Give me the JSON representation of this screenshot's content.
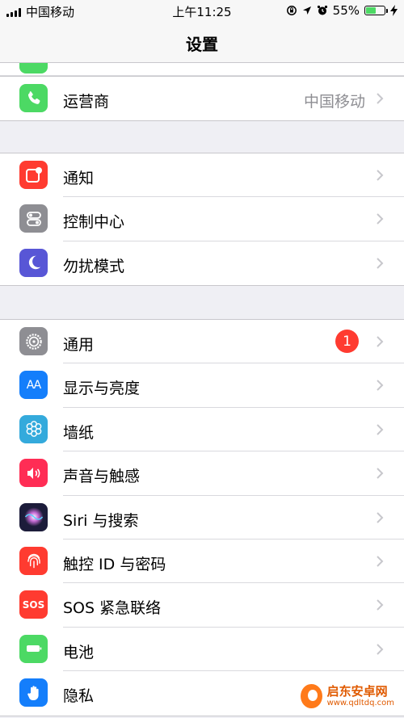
{
  "status_bar": {
    "carrier": "中国移动",
    "time": "上午11:25",
    "battery_percent": "55%",
    "battery_level": 0.55
  },
  "nav": {
    "title": "设置"
  },
  "groups": [
    {
      "rows": [
        {
          "label": "运营商",
          "value": "中国移动",
          "icon": "phone-icon"
        }
      ]
    },
    {
      "rows": [
        {
          "label": "通知",
          "icon": "notifications-icon"
        },
        {
          "label": "控制中心",
          "icon": "control-center-icon"
        },
        {
          "label": "勿扰模式",
          "icon": "moon-icon"
        }
      ]
    },
    {
      "rows": [
        {
          "label": "通用",
          "badge": "1",
          "icon": "gear-icon"
        },
        {
          "label": "显示与亮度",
          "icon": "display-icon"
        },
        {
          "label": "墙纸",
          "icon": "wallpaper-icon"
        },
        {
          "label": "声音与触感",
          "icon": "sound-icon"
        },
        {
          "label": "Siri 与搜索",
          "icon": "siri-icon"
        },
        {
          "label": "触控 ID 与密码",
          "icon": "fingerprint-icon"
        },
        {
          "label": "SOS 紧急联络",
          "icon": "sos-icon"
        },
        {
          "label": "电池",
          "icon": "battery-icon"
        },
        {
          "label": "隐私",
          "icon": "hand-icon"
        }
      ]
    }
  ],
  "icons": {
    "display_text": "AA",
    "sos_text": "SOS"
  },
  "colors": {
    "phone": "#4cd964",
    "notifications": "#ff3b30",
    "control_center": "#8e8e93",
    "moon": "#5856d6",
    "gear": "#8e8e93",
    "display": "#147efb",
    "wallpaper": "#34aadc",
    "sound": "#ff2d55",
    "siri": "#1c1c3a",
    "fingerprint": "#ff3b30",
    "sos": "#ff3b30",
    "battery": "#4cd964",
    "hand": "#147efb"
  },
  "watermark": {
    "title": "启东安卓网",
    "url": "www.qdltdq.com"
  }
}
